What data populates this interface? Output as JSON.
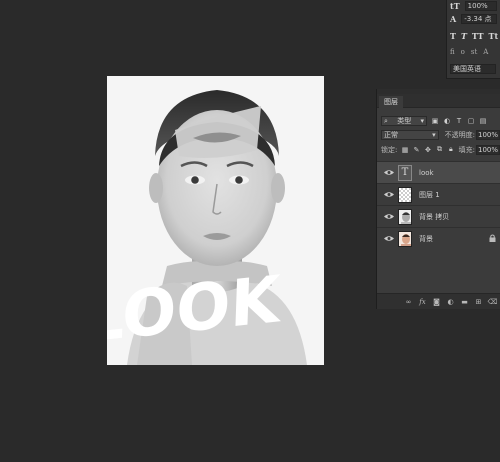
{
  "character_panel": {
    "font_size_glyph": "tT",
    "scale_value": "100%",
    "baseline_glyph": "A",
    "baseline_value": "-3.34 点",
    "style_glyphs": [
      "T",
      "T",
      "TT",
      "Tt"
    ],
    "opentype_glyphs": [
      "fi",
      "o",
      "st",
      "A"
    ],
    "language": "美国英语"
  },
  "canvas": {
    "overlay_text": "LOOK"
  },
  "layers_panel": {
    "tab_label": "图层",
    "filter_label": "类型",
    "blend_mode": "正常",
    "opacity_label": "不透明度:",
    "opacity_value": "100%",
    "lock_label": "锁定:",
    "fill_label": "填充:",
    "fill_value": "100%",
    "layers": [
      {
        "name": "look",
        "type": "text",
        "selected": true,
        "thumb_text": "T"
      },
      {
        "name": "图层 1",
        "type": "transparent",
        "selected": false
      },
      {
        "name": "背景 拷贝",
        "type": "photo-gray",
        "selected": false
      },
      {
        "name": "背景",
        "type": "photo-color",
        "selected": false,
        "locked": true
      }
    ]
  }
}
